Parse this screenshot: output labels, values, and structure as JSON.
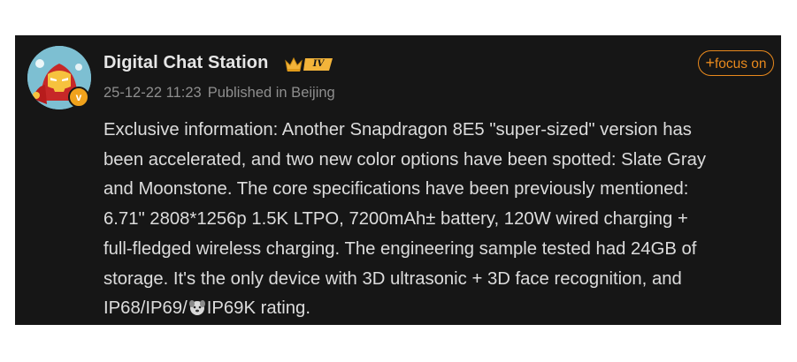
{
  "post": {
    "author": {
      "name": "Digital Chat Station",
      "level_badge": "IV",
      "verified_mark": "v",
      "avatar_icon": "iron-man-avatar"
    },
    "timestamp": "25-12-22 11:23",
    "location": "Published in Beijing",
    "follow_button": {
      "plus": "+",
      "label": "focus on"
    },
    "lines": [
      "Exclusive information: Another Snapdragon 8E5 \"super-sized\" version has",
      "been accelerated, and two new color options have been spotted: Slate Gray",
      "and Moonstone. The core specifications have been previously mentioned:",
      "6.71\" 2808*1256p 1.5K LTPO, 7200mAh± battery, 120W wired charging +",
      "full-fledged wireless charging. The engineering sample tested had 24GB of",
      "storage. It's the only device with 3D ultrasonic + 3D face recognition, and"
    ],
    "last_line_before_emoji": "IP68/IP69/",
    "emoji_icon": "dog-face-emoji",
    "last_line_after_emoji": "IP69K rating."
  },
  "colors": {
    "card_background": "#161616",
    "accent_orange": "#e8891d",
    "text_primary": "#dcdcdc",
    "text_secondary": "#8e8e8e",
    "badge_gold": "#f0a21c"
  }
}
